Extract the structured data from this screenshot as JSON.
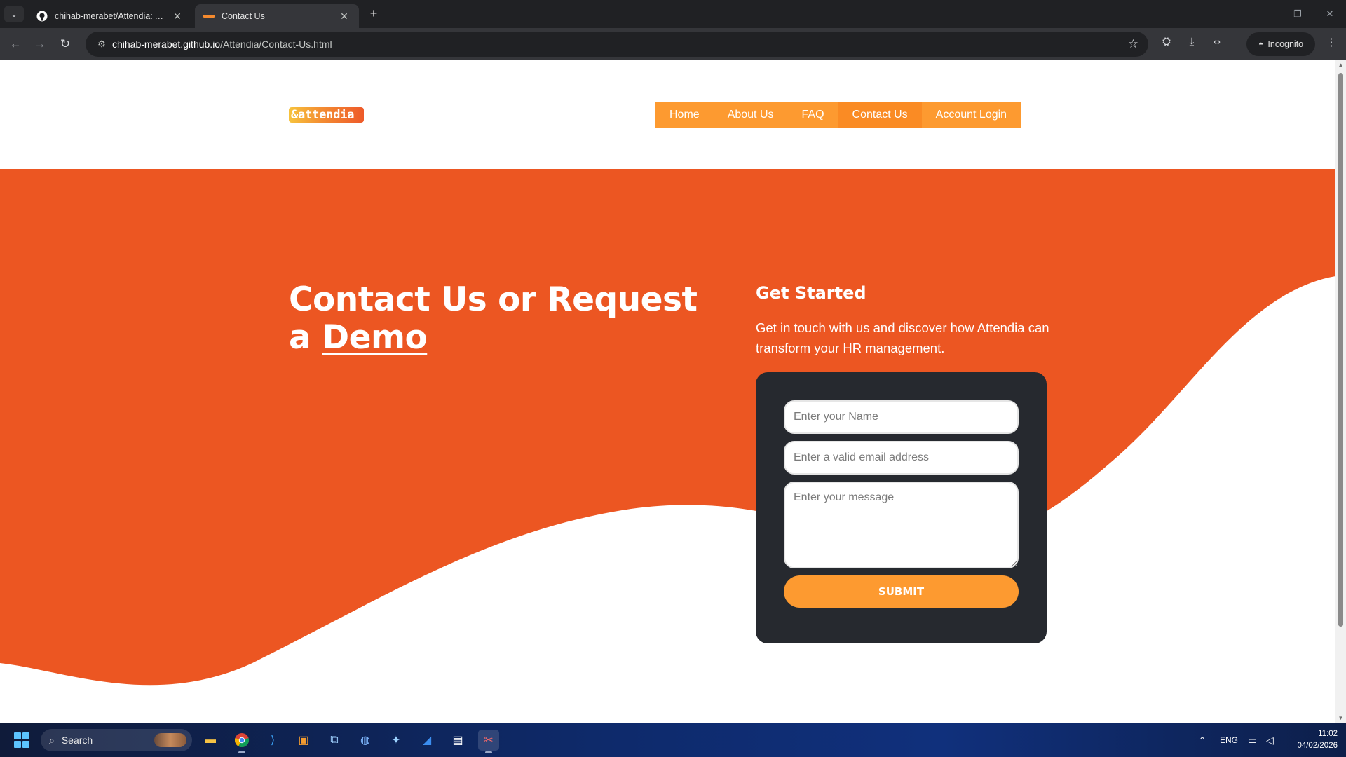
{
  "browser": {
    "tabs": [
      {
        "title": "chihab-merabet/Attendia: Attendia",
        "active": false
      },
      {
        "title": "Contact Us",
        "active": true
      }
    ],
    "url_host": "chihab-merabet.github.io",
    "url_path": "/Attendia/Contact-Us.html",
    "incognito_label": "Incognito"
  },
  "site": {
    "logo_text": "&attendia",
    "nav": [
      {
        "label": "Home"
      },
      {
        "label": "About Us"
      },
      {
        "label": "FAQ"
      },
      {
        "label": "Contact Us",
        "active": true
      },
      {
        "label": "Account Login"
      }
    ],
    "hero": {
      "title_line1": "Contact Us or Request",
      "title_prefix": "a ",
      "title_link": "Demo"
    },
    "get_started": {
      "title": "Get Started",
      "text": "Get in touch with us and discover how Attendia can transform your HR management."
    },
    "form": {
      "name_placeholder": "Enter your Name",
      "email_placeholder": "Enter a valid email address",
      "message_placeholder": "Enter your message",
      "submit_label": "SUBMIT"
    }
  },
  "taskbar": {
    "search_label": "Search",
    "language": "ENG",
    "time": "11:02",
    "date": "04/02/2026"
  },
  "colors": {
    "hero_orange": "#ec5622",
    "nav_orange": "#fd9a30",
    "form_bg": "#26292f"
  }
}
